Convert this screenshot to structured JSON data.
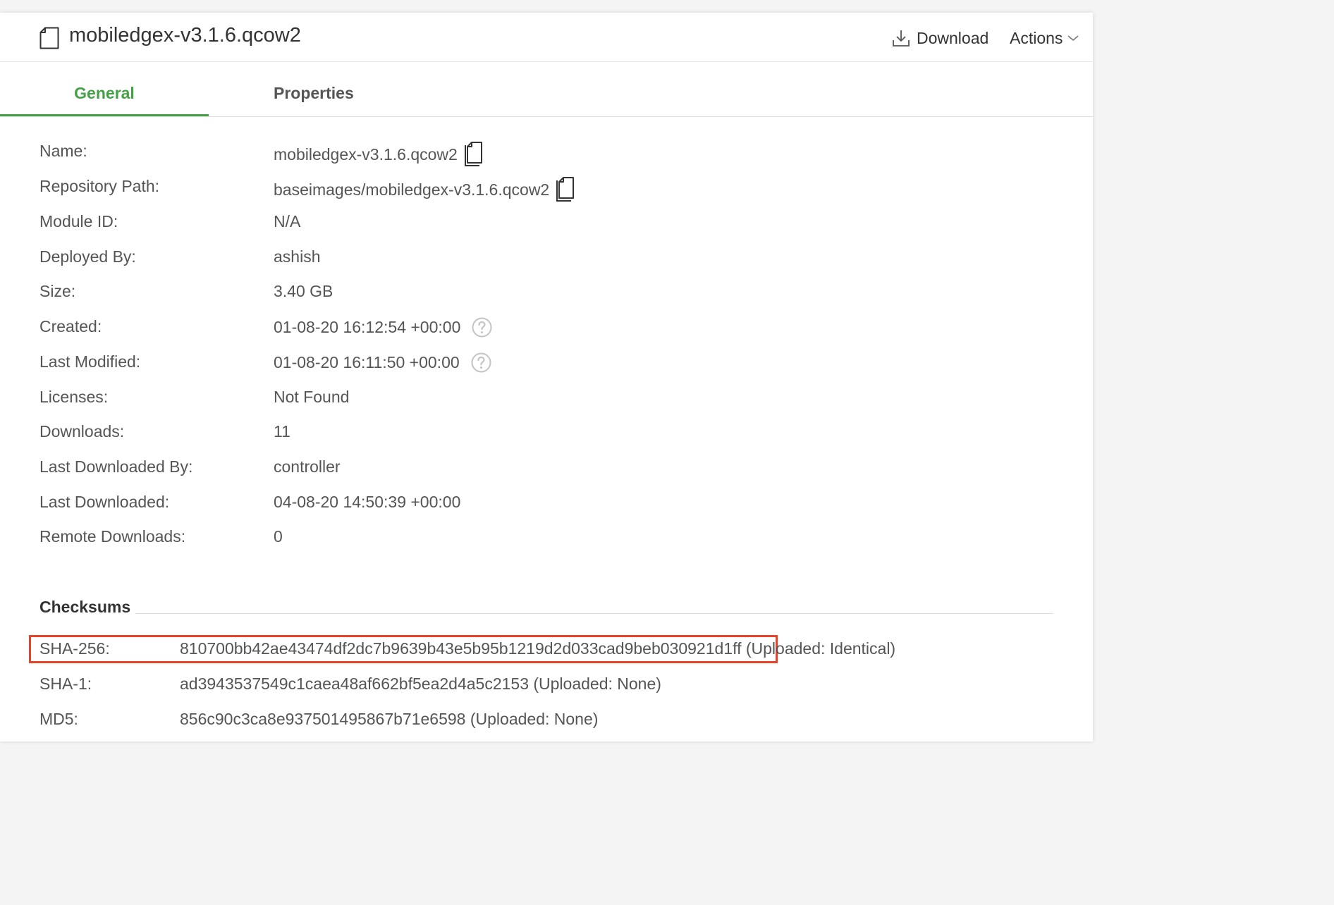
{
  "header": {
    "title": "mobiledgex-v3.1.6.qcow2",
    "download_label": "Download",
    "actions_label": "Actions"
  },
  "tabs": {
    "general": "General",
    "properties": "Properties"
  },
  "general": {
    "rows": [
      {
        "label": "Name:",
        "value": "mobiledgex-v3.1.6.qcow2"
      },
      {
        "label": "Repository Path:",
        "value": "baseimages/mobiledgex-v3.1.6.qcow2"
      },
      {
        "label": "Module ID:",
        "value": "N/A"
      },
      {
        "label": "Deployed By:",
        "value": "ashish"
      },
      {
        "label": "Size:",
        "value": "3.40 GB"
      },
      {
        "label": "Created:",
        "value": "01-08-20 16:12:54 +00:00"
      },
      {
        "label": "Last Modified:",
        "value": "01-08-20 16:11:50 +00:00"
      },
      {
        "label": "Licenses:",
        "value": "Not Found"
      },
      {
        "label": "Downloads:",
        "value": "11"
      },
      {
        "label": "Last Downloaded By:",
        "value": "controller"
      },
      {
        "label": "Last Downloaded:",
        "value": "04-08-20 14:50:39 +00:00"
      },
      {
        "label": "Remote Downloads:",
        "value": "0"
      }
    ]
  },
  "checksums": {
    "title": "Checksums",
    "rows": [
      {
        "label": "SHA-256:",
        "value": "810700bb42ae43474df2dc7b9639b43e5b95b1219d2d033cad9beb030921d1ff",
        "status": "(Uploaded: Identical)"
      },
      {
        "label": "SHA-1:",
        "value": "ad3943537549c1caea48af662bf5ea2d4a5c2153",
        "status": "(Uploaded: None)"
      },
      {
        "label": "MD5:",
        "value": "856c90c3ca8e937501495867b71e6598",
        "status": "(Uploaded: None)"
      }
    ]
  },
  "colors": {
    "accent_green": "#43a047",
    "highlight_red": "#e8432a"
  },
  "icons": {
    "file": "file-icon",
    "download": "download-icon",
    "chevron": "chevron-down-icon",
    "copy": "copy-icon",
    "help": "help-icon"
  }
}
